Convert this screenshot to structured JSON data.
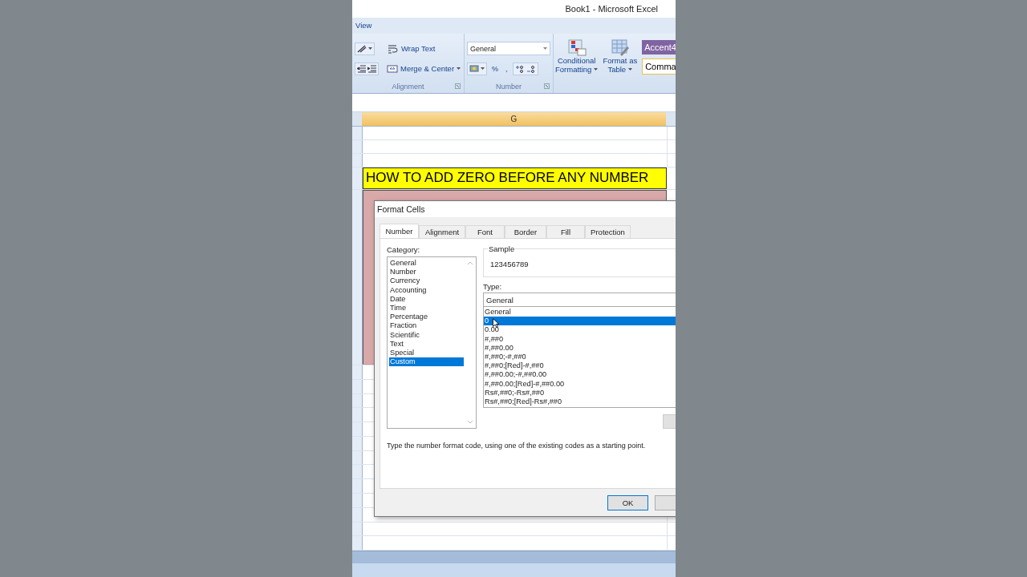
{
  "window": {
    "title": "Book1 - Microsoft Excel"
  },
  "ribbon_tabs": [
    {
      "label": "View"
    }
  ],
  "ribbon": {
    "alignment": {
      "wrap_text": "Wrap Text",
      "merge_center": "Merge & Center",
      "label": "Alignment"
    },
    "number": {
      "format": "General",
      "percent": "%",
      "comma": ",",
      "label": "Number"
    },
    "styles": {
      "buttons": [
        {
          "kind": "conditional",
          "lines": [
            "Conditional",
            "Formatting"
          ]
        },
        {
          "kind": "table",
          "lines": [
            "Format as",
            "Table"
          ]
        }
      ],
      "cell_styles": [
        {
          "label": "Accent4",
          "color": "#8064a2"
        },
        {
          "label": "Comma",
          "color": "#ffffff"
        }
      ]
    }
  },
  "sheet": {
    "column": "G",
    "title": "HOW TO ADD ZERO BEFORE ANY NUMBER"
  },
  "dialog": {
    "title": "Format Cells",
    "tabs": [
      {
        "label": "Number",
        "selected": true
      },
      {
        "label": "Alignment",
        "selected": false
      },
      {
        "label": "Font",
        "selected": false
      },
      {
        "label": "Border",
        "selected": false
      },
      {
        "label": "Fill",
        "selected": false
      },
      {
        "label": "Protection",
        "selected": false
      }
    ],
    "category_label": "Category:",
    "categories": [
      {
        "label": "General",
        "selected": false
      },
      {
        "label": "Number",
        "selected": false
      },
      {
        "label": "Currency",
        "selected": false
      },
      {
        "label": "Accounting",
        "selected": false
      },
      {
        "label": "Date",
        "selected": false
      },
      {
        "label": "Time",
        "selected": false
      },
      {
        "label": "Percentage",
        "selected": false
      },
      {
        "label": "Fraction",
        "selected": false
      },
      {
        "label": "Scientific",
        "selected": false
      },
      {
        "label": "Text",
        "selected": false
      },
      {
        "label": "Special",
        "selected": false
      },
      {
        "label": "Custom",
        "selected": true
      }
    ],
    "sample_label": "Sample",
    "sample": "123456789",
    "type_label": "Type:",
    "type_value": "General",
    "types": [
      {
        "label": "General",
        "selected": false
      },
      {
        "label": "0",
        "selected": true
      },
      {
        "label": "0.00",
        "selected": false
      },
      {
        "label": "#,##0",
        "selected": false
      },
      {
        "label": "#,##0.00",
        "selected": false
      },
      {
        "label": "#,##0;-#,##0",
        "selected": false
      },
      {
        "label": "#,##0;[Red]-#,##0",
        "selected": false
      },
      {
        "label": "#,##0.00;-#,##0.00",
        "selected": false
      },
      {
        "label": "#,##0.00;[Red]-#,##0.00",
        "selected": false
      },
      {
        "label": "Rs#,##0;-Rs#,##0",
        "selected": false
      },
      {
        "label": "Rs#,##0;[Red]-Rs#,##0",
        "selected": false
      }
    ],
    "description": "Type the number format code, using one of the existing codes as a starting point.",
    "buttons": [
      "OK"
    ]
  }
}
